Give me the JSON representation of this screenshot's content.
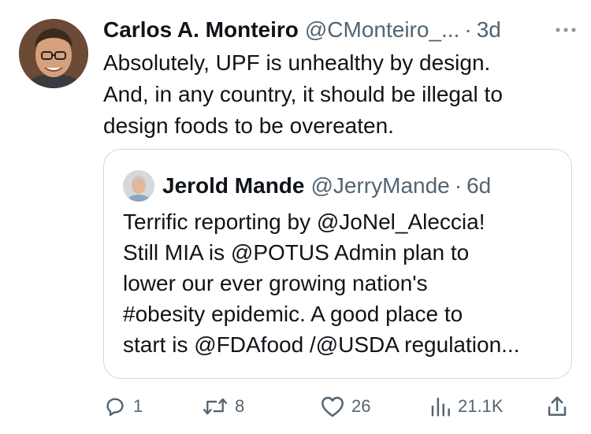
{
  "tweet": {
    "author_name": "Carlos A. Monteiro",
    "handle": "@CMonteiro_...",
    "separator": "·",
    "time": "3d",
    "text": "Absolutely, UPF is unhealthy by design.\nAnd, in any country, it should be illegal to\ndesign foods to be overeaten."
  },
  "quote": {
    "author_name": "Jerold Mande",
    "handle": "@JerryMande",
    "separator": "·",
    "time": "6d",
    "text": "Terrific reporting by @JoNel_Aleccia!\nStill MIA is @POTUS Admin plan to\nlower our ever growing nation's\n#obesity epidemic. A good place to\nstart is @FDAfood /@USDA regulation..."
  },
  "actions": {
    "replies": "1",
    "reposts": "8",
    "likes": "26",
    "views": "21.1K"
  },
  "icons": {
    "more": "more-dots-icon",
    "reply": "reply-icon",
    "repost": "repost-icon",
    "like": "heart-icon",
    "views": "views-chart-icon",
    "share": "share-icon"
  },
  "colors": {
    "text": "#0f1419",
    "secondary": "#536471",
    "border": "#cfd9de"
  }
}
